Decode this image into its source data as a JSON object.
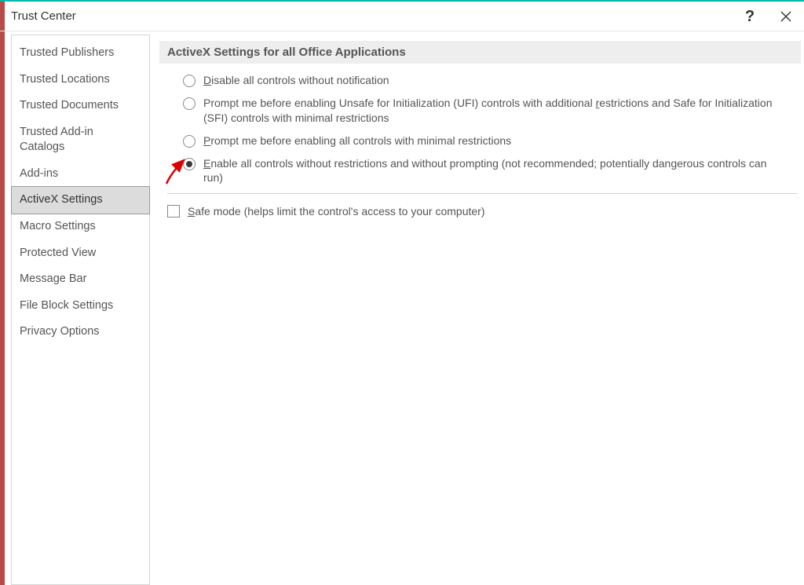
{
  "window": {
    "title": "Trust Center"
  },
  "sidebar": {
    "items": [
      {
        "label": "Trusted Publishers"
      },
      {
        "label": "Trusted Locations"
      },
      {
        "label": "Trusted Documents"
      },
      {
        "label": "Trusted Add-in Catalogs"
      },
      {
        "label": "Add-ins"
      },
      {
        "label": "ActiveX Settings",
        "selected": true
      },
      {
        "label": "Macro Settings"
      },
      {
        "label": "Protected View"
      },
      {
        "label": "Message Bar"
      },
      {
        "label": "File Block Settings"
      },
      {
        "label": "Privacy Options"
      }
    ]
  },
  "main": {
    "section_title": "ActiveX Settings for all Office Applications",
    "radio_options": [
      {
        "text_before": "",
        "underlined": "D",
        "text_after": "isable all controls without notification",
        "selected": false
      },
      {
        "text_before": "Prompt me before enabling Unsafe for Initialization (UFI) controls with additional ",
        "underlined": "r",
        "text_after": "estrictions and Safe for Initialization (SFI) controls with minimal restrictions",
        "selected": false
      },
      {
        "text_before": "",
        "underlined": "P",
        "text_after": "rompt me before enabling all controls with minimal restrictions",
        "selected": false
      },
      {
        "text_before": "",
        "underlined": "E",
        "text_after": "nable all controls without restrictions and without prompting (not recommended; potentially dangerous controls can run)",
        "selected": true
      }
    ],
    "checkbox": {
      "text_before": "",
      "underlined": "S",
      "text_after": "afe mode (helps limit the control's access to your computer)",
      "checked": false
    }
  }
}
